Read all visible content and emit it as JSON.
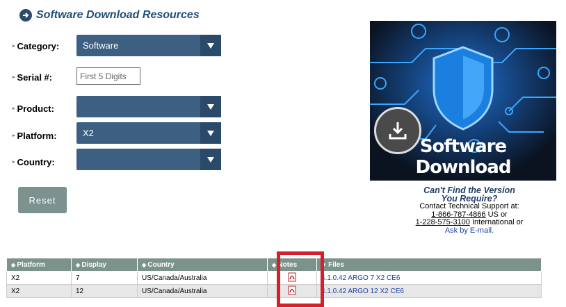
{
  "header": {
    "title": "Software Download Resources",
    "title_icon": "circle-arrow-right-icon"
  },
  "form": {
    "category": {
      "label": "Category:",
      "value": "Software"
    },
    "serial": {
      "label": "Serial #:",
      "placeholder": "First 5 Digits"
    },
    "product": {
      "label": "Product:",
      "value": ""
    },
    "platform": {
      "label": "Platform:",
      "value": "X2"
    },
    "country": {
      "label": "Country:",
      "value": ""
    },
    "reset_label": "Reset"
  },
  "banner": {
    "text": "Software Download",
    "icon": "download-icon"
  },
  "support": {
    "heading_line1": "Can't Find the Version",
    "heading_line2": "You Require?",
    "contact": "Contact Technical Support at:",
    "phone_us": "1-866-787-4866",
    "phone_us_suffix": " US or",
    "phone_intl": "1-228-575-3100",
    "phone_intl_suffix": " International or",
    "email_link": "Ask by E-mail."
  },
  "table": {
    "headers": [
      "Platform",
      "Display",
      "Country",
      "Notes",
      "Files"
    ],
    "rows": [
      {
        "platform": "X2",
        "display": "7",
        "country": "US/Canada/Australia",
        "file": "4.1.0.42 ARGO 7 X2 CE6"
      },
      {
        "platform": "X2",
        "display": "12",
        "country": "US/Canada/Australia",
        "file": "4.1.0.42 ARGO 12 X2 CE6"
      }
    ]
  },
  "colors": {
    "accent": "#3d5f82",
    "title": "#1f4e79",
    "table_header": "#7c938c",
    "highlight": "#d4202a",
    "link": "#1a3fa6"
  }
}
